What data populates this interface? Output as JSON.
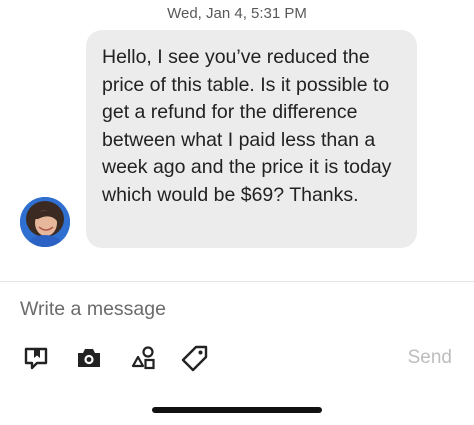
{
  "conversation": {
    "timestamp": "Wed, Jan 4, 5:31 PM",
    "message": {
      "text": "Hello, I see you’ve reduced the price of this table. Is it possible to get a refund for the difference between what I paid less than a week ago and the price it is today which would be $69? Thanks."
    }
  },
  "composer": {
    "placeholder": "Write a message",
    "value": "",
    "send_label": "Send",
    "send_color": "#bdbdbd",
    "tools": [
      "listing-icon",
      "camera-icon",
      "shapes-icon",
      "tag-icon"
    ]
  },
  "theme": {
    "bubble_color": "#ececec",
    "text_color": "#222222"
  }
}
